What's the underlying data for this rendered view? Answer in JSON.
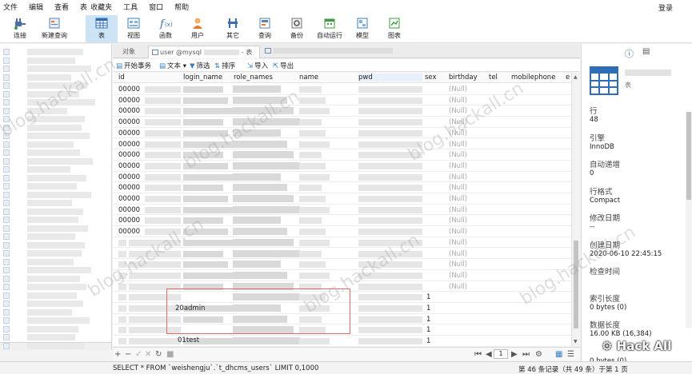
{
  "menu": [
    "文件",
    "编辑",
    "查看",
    "表",
    "收藏夹",
    "工具",
    "窗口",
    "帮助"
  ],
  "login": "登录",
  "toolbar": [
    {
      "label": "连接",
      "icon": "plug-icon"
    },
    {
      "label": "新建查询",
      "icon": "new-query-icon"
    },
    {
      "label": "表",
      "icon": "table-icon"
    },
    {
      "label": "视图",
      "icon": "view-icon"
    },
    {
      "label": "函数",
      "icon": "function-icon"
    },
    {
      "label": "用户",
      "icon": "user-icon"
    },
    {
      "label": "其它",
      "icon": "tools-icon"
    },
    {
      "label": "查询",
      "icon": "query-icon"
    },
    {
      "label": "备份",
      "icon": "backup-icon"
    },
    {
      "label": "自动运行",
      "icon": "schedule-icon"
    },
    {
      "label": "模型",
      "icon": "model-icon"
    },
    {
      "label": "图表",
      "icon": "chart-icon"
    }
  ],
  "tabs": {
    "objects": "对象",
    "query_tab": "user @mysql",
    "query_tab_suffix": "- 表"
  },
  "actions": {
    "begin_txn": "开始事务",
    "text": "文本",
    "filter": "筛选",
    "sort": "排序",
    "import": "导入",
    "export": "导出"
  },
  "columns": [
    "id",
    "login_name",
    "role_names",
    "name",
    "pwd",
    "sex",
    "birthday",
    "tel",
    "mobilephone",
    "e"
  ],
  "rows": {
    "id_prefix": "00000",
    "null_text": "(Null)",
    "one": "1",
    "login_a": "20admin",
    "login_b": "01test"
  },
  "right_panel": {
    "table_caption": "表",
    "fields": [
      {
        "label": "行",
        "value": "48"
      },
      {
        "label": "引擎",
        "value": "InnoDB"
      },
      {
        "label": "自动递增",
        "value": "0"
      },
      {
        "label": "行格式",
        "value": "Compact"
      },
      {
        "label": "修改日期",
        "value": "--"
      },
      {
        "label": "创建日期",
        "value": "2020-06-10 22:45:15"
      },
      {
        "label": "检查时间",
        "value": ""
      },
      {
        "label": "索引长度",
        "value": "0 bytes (0)"
      },
      {
        "label": "数据长度",
        "value": "16.00 KB (16,384)"
      },
      {
        "label": "",
        "value": "0 bytes (0)"
      }
    ]
  },
  "status": {
    "sql": "SELECT * FROM `weishengju`.`t_dhcms_users` LIMIT 0,1000",
    "records": "第 46 条记录（共 49 条）于第 1 页",
    "page": "1"
  },
  "watermark": "blog.hackall.cn",
  "brand": "Hack All"
}
